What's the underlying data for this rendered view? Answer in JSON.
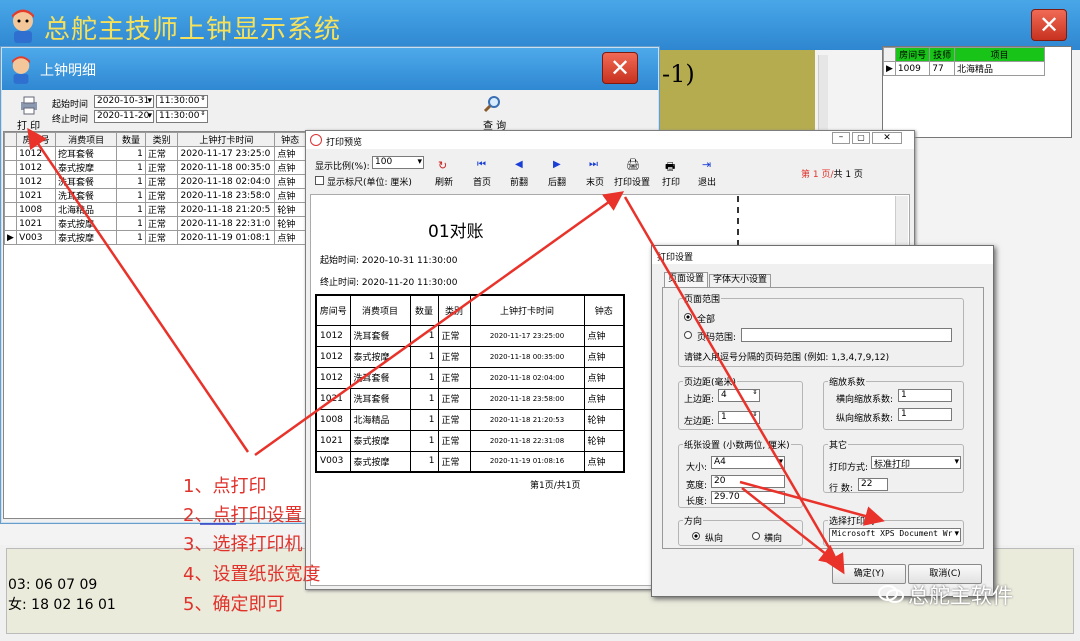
{
  "main_window": {
    "title": "总舵主技师上钟显示系统",
    "obscured_text": "-1)"
  },
  "right_table": {
    "headers": [
      "房间号",
      "技师",
      "项目"
    ],
    "rows": [
      [
        "1009",
        "77",
        "北海精品"
      ]
    ]
  },
  "bottom_panel": {
    "line1": "03: 06 07 09",
    "line2": "女: 18 02 16 01"
  },
  "detail_window": {
    "title": "上钟明细",
    "print_label": "打 印",
    "query_label": "查 询",
    "start_label": "起始时间",
    "end_label": "终止时间",
    "start_date": "2020-10-31",
    "start_time": "11:30:00",
    "end_date": "2020-11-20",
    "end_time": "11:30:00",
    "headers": [
      "房间号",
      "消费项目",
      "数量",
      "类别",
      "上钟打卡时间",
      "钟态"
    ],
    "rows": [
      [
        "1012",
        "挖耳套餐",
        "1",
        "正常",
        "2020-11-17 23:25:0",
        "点钟"
      ],
      [
        "1012",
        "泰式按摩",
        "1",
        "正常",
        "2020-11-18 00:35:0",
        "点钟"
      ],
      [
        "1012",
        "洗耳套餐",
        "1",
        "正常",
        "2020-11-18 02:04:0",
        "点钟"
      ],
      [
        "1021",
        "洗耳套餐",
        "1",
        "正常",
        "2020-11-18 23:58:0",
        "点钟"
      ],
      [
        "1008",
        "北海精品",
        "1",
        "正常",
        "2020-11-18 21:20:5",
        "轮钟"
      ],
      [
        "1021",
        "泰式按摩",
        "1",
        "正常",
        "2020-11-18 22:31:0",
        "轮钟"
      ],
      [
        "V003",
        "泰式按摩",
        "1",
        "正常",
        "2020-11-19 01:08:1",
        "点钟"
      ]
    ]
  },
  "preview_window": {
    "title": "打印预览",
    "scale_label": "显示比例(%):",
    "scale_value": "100",
    "ruler_label": "显示标尺(单位: 厘米)",
    "toolbar": [
      "刷新",
      "首页",
      "前翻",
      "后翻",
      "末页",
      "打印设置",
      "打印",
      "退出"
    ],
    "page_indicator_current": "第 1 页/",
    "page_indicator_total": "共 1 页",
    "doc_title": "01对账",
    "doc_start": "起始时间: 2020-10-31 11:30:00",
    "doc_end": "终止时间: 2020-11-20 11:30:00",
    "doc_headers": [
      "房间号",
      "消费项目",
      "数量",
      "类别",
      "上钟打卡时间",
      "钟态"
    ],
    "doc_rows": [
      [
        "1012",
        "洗耳套餐",
        "1",
        "正常",
        "2020-11-17 23:25:00",
        "点钟"
      ],
      [
        "1012",
        "泰式按摩",
        "1",
        "正常",
        "2020-11-18 00:35:00",
        "点钟"
      ],
      [
        "1012",
        "洗耳套餐",
        "1",
        "正常",
        "2020-11-18 02:04:00",
        "点钟"
      ],
      [
        "1021",
        "洗耳套餐",
        "1",
        "正常",
        "2020-11-18 23:58:00",
        "点钟"
      ],
      [
        "1008",
        "北海精品",
        "1",
        "正常",
        "2020-11-18 21:20:53",
        "轮钟"
      ],
      [
        "1021",
        "泰式按摩",
        "1",
        "正常",
        "2020-11-18 22:31:08",
        "轮钟"
      ],
      [
        "V003",
        "泰式按摩",
        "1",
        "正常",
        "2020-11-19 01:08:16",
        "点钟"
      ]
    ],
    "doc_footer": "第1页/共1页"
  },
  "print_settings": {
    "title": "打印设置",
    "tabs": [
      "页面设置",
      "字体大小设置"
    ],
    "page_range_legend": "页面范围",
    "all_label": "全部",
    "range_label": "页码范围:",
    "range_hint": "请键入用逗号分隔的页码范围 (例如: 1,3,4,7,9,12)",
    "margin_legend": "页边距(毫米)",
    "top_label": "上边距:",
    "top_value": "4",
    "left_label": "左边距:",
    "left_value": "1",
    "scale_legend": "缩放系数",
    "hscale_label": "横向缩放系数:",
    "hscale_value": "1",
    "vscale_label": "纵向缩放系数:",
    "vscale_value": "1",
    "paper_legend": "纸张设置 (小数两位, 厘米)",
    "size_label": "大小:",
    "size_value": "A4",
    "width_label": "宽度:",
    "width_value": "20",
    "length_label": "长度:",
    "length_value": "29.70",
    "other_legend": "其它",
    "print_mode_label": "打印方式:",
    "print_mode_value": "标准打印",
    "rows_label": "行 数:",
    "rows_value": "22",
    "orientation_legend": "方向",
    "portrait_label": "纵向",
    "landscape_label": "横向",
    "printer_legend": "选择打印机",
    "printer_value": "Microsoft XPS Document Wr",
    "ok_label": "确定(Y)",
    "cancel_label": "取消(C)"
  },
  "instructions": [
    "1、点打印",
    "2、点打印设置",
    "3、选择打印机",
    "4、设置纸张宽度",
    "5、确定即可"
  ],
  "watermark": "总舵主软件",
  "colors": {
    "arrow": "#e8322a",
    "title_bar": "#3a93dc",
    "title_text": "#f7e15a",
    "selected_green": "#19c419"
  }
}
